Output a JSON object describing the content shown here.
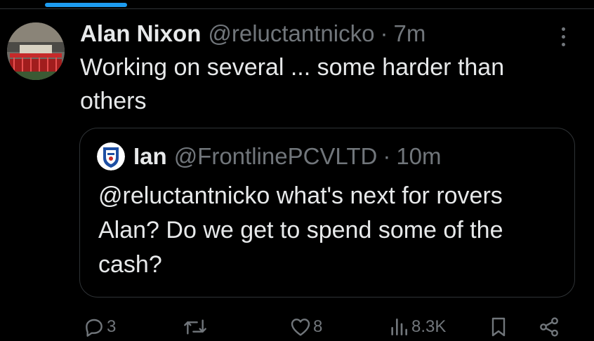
{
  "tweet": {
    "author_name": "Alan Nixon",
    "author_handle": "@reluctantnicko",
    "time": "7m",
    "text": "Working on several ... some harder than others"
  },
  "quoted_tweet": {
    "author_name": "Ian",
    "author_handle": "@FrontlinePCVLTD",
    "time": "10m",
    "text": "@reluctantnicko what's next for rovers Alan? Do we get to spend some of the cash?"
  },
  "actions": {
    "replies": "3",
    "reposts": "",
    "likes": "8",
    "views": "8.3K"
  },
  "separator": "·",
  "icons": {
    "more": "more-vertical-icon",
    "reply": "reply-icon",
    "repost": "repost-icon",
    "like": "heart-icon",
    "views": "analytics-icon",
    "bookmark": "bookmark-icon",
    "share": "share-icon"
  },
  "colors": {
    "background": "#000000",
    "text": "#e7e9ea",
    "muted": "#71767b",
    "accent": "#1d9bf0",
    "border": "#2f3336"
  }
}
